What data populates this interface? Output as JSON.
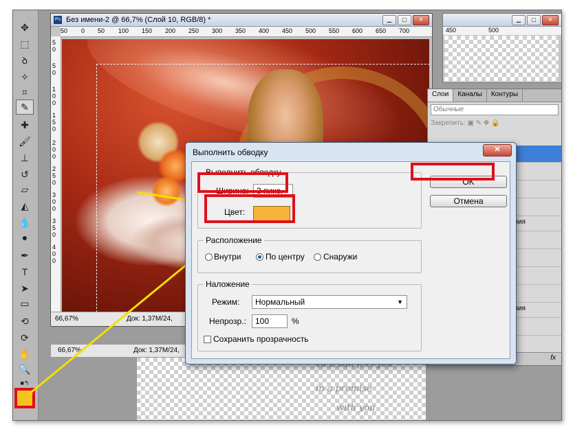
{
  "document": {
    "title": "Без имени-2 @ 66,7% (Слой 10, RGB/8) *",
    "ruler_h": [
      "50",
      "0",
      "50",
      "100",
      "150",
      "200",
      "250",
      "300",
      "350",
      "400",
      "450",
      "500",
      "550",
      "600",
      "650",
      "700"
    ],
    "ruler_v": [
      "5",
      "0",
      "5",
      "0",
      "1",
      "0",
      "0",
      "1",
      "5",
      "0",
      "2",
      "0",
      "0",
      "2",
      "5",
      "0",
      "3",
      "0",
      "0",
      "3",
      "5",
      "0",
      "4",
      "0",
      "0"
    ],
    "zoom": "66,67%",
    "doc_size": "Док: 1,37М/24,"
  },
  "document2": {
    "zoom": "66,67%",
    "doc_size": "Док: 1,37М/24,"
  },
  "nav_ruler": [
    "450",
    "500"
  ],
  "layers_panel": {
    "tabs": [
      "Слои",
      "Каналы",
      "Контуры"
    ],
    "blend_mode": "Обычные",
    "lock_label": "Закрепить:",
    "layer_labels": [
      "опия",
      "опия"
    ],
    "footer_fx": "fx"
  },
  "dialog": {
    "title": "Выполнить обводку",
    "close_label": "✕",
    "stroke_group": "Выполнить обводку",
    "width_label": "Ширина:",
    "width_value": "3 пикс.",
    "color_label": "Цвет:",
    "color_value": "#f7b43b",
    "location_group": "Расположение",
    "location_options": [
      "Внутри",
      "По центру",
      "Снаружи"
    ],
    "location_selected": "По центру",
    "blending_group": "Наложение",
    "mode_label": "Режим:",
    "mode_value": "Нормальный",
    "opacity_label": "Непрозр.:",
    "opacity_value": "100",
    "opacity_unit": "%",
    "preserve_label": "Сохранить прозрачность",
    "preserve_checked": false,
    "ok_label": "OK",
    "cancel_label": "Отмена"
  },
  "background_text": [
    "Ta L can feel you",
    "in a promise",
    "with you"
  ],
  "annotation_color": "#e0101a",
  "foreground_color": "#f5c320"
}
